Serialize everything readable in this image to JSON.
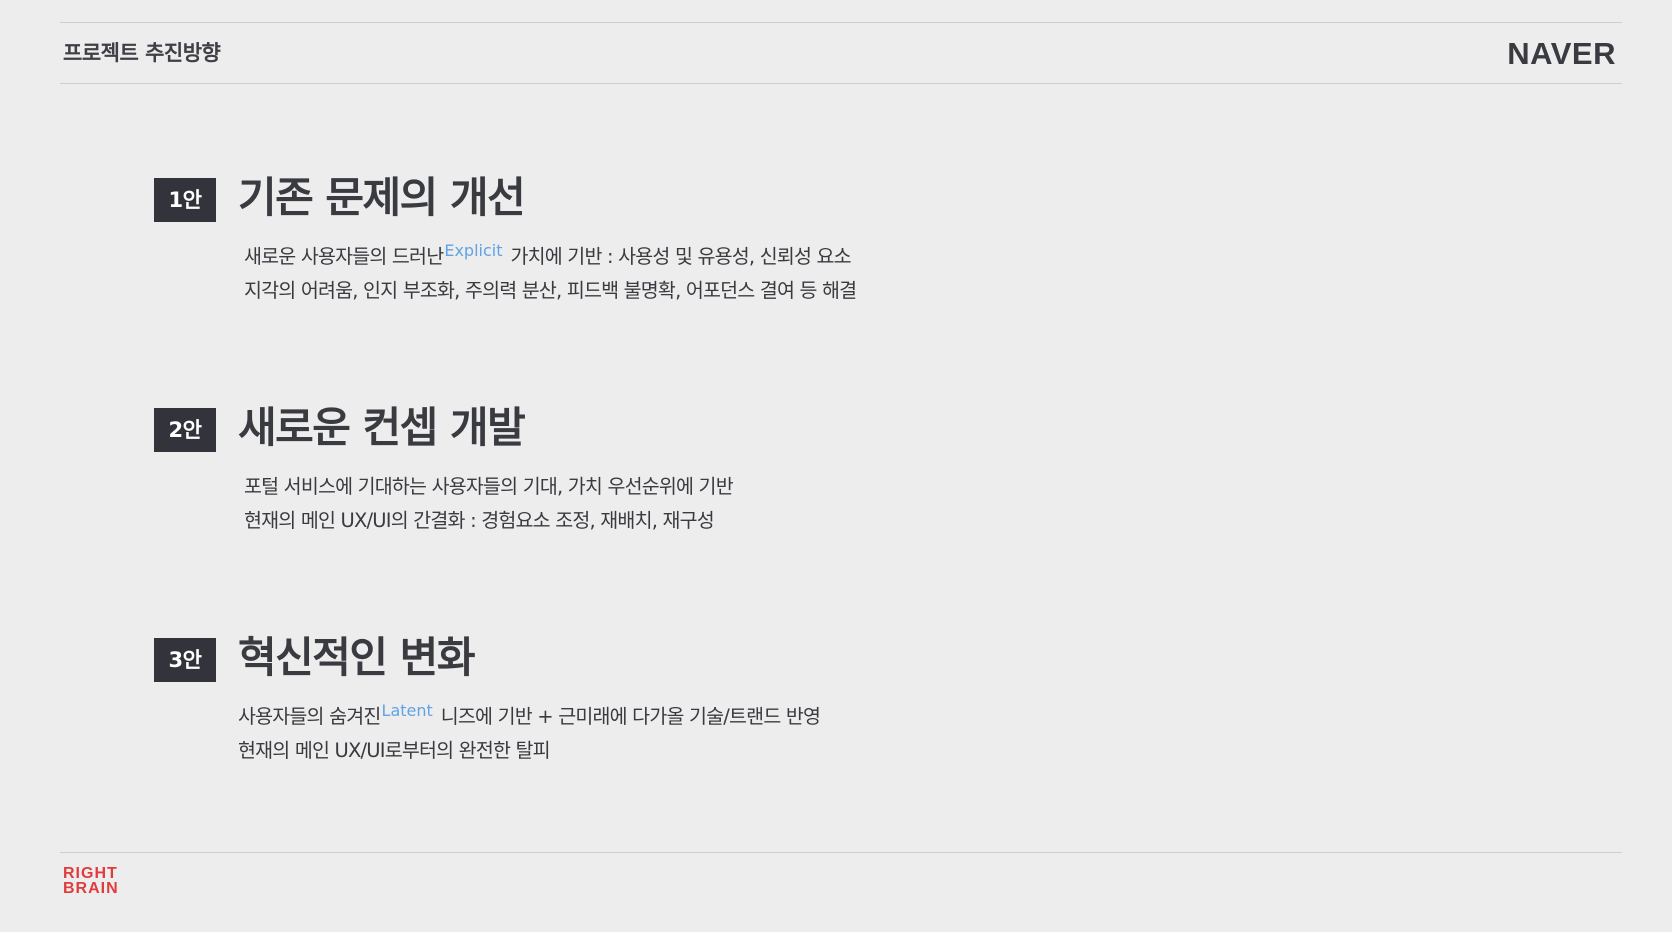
{
  "header": {
    "title": "프로젝트 추진방향",
    "logo_text": "NAVER"
  },
  "sections": [
    {
      "badge": "1안",
      "title": "기존 문제의 개선",
      "lines": [
        {
          "before": "새로운 사용자들의 드러난",
          "sup": "Explicit",
          "after": "가치에 기반 : 사용성 및 유용성, 신뢰성 요소"
        },
        {
          "text": "지각의 어려움, 인지 부조화, 주의력 분산, 피드백 불명확, 어포던스 결여 등 해결"
        }
      ]
    },
    {
      "badge": "2안",
      "title": "새로운 컨셉 개발",
      "lines": [
        {
          "text": "포털 서비스에 기대하는 사용자들의 기대, 가치 우선순위에 기반"
        },
        {
          "text": "현재의 메인 UX/UI의 간결화 : 경험요소 조정, 재배치, 재구성"
        }
      ]
    },
    {
      "badge": "3안",
      "title": "혁신적인 변화",
      "lines": [
        {
          "before": "사용자들의 숨겨진",
          "sup": "Latent",
          "after": "니즈에 기반 + 근미래에 다가올 기술/트랜드 반영"
        },
        {
          "text": "현재의 메인 UX/UI로부터의 완전한 탈피"
        }
      ]
    }
  ],
  "footer": {
    "logo_line1": "RIGHT",
    "logo_line2": "BRAIN"
  },
  "colors": {
    "background": "#ededed",
    "text": "#3a3b40",
    "badge_bg": "#33343b",
    "accent_sup": "#5fa3e6",
    "footer_logo": "#e03c3c",
    "rule": "#cfcfcf"
  }
}
